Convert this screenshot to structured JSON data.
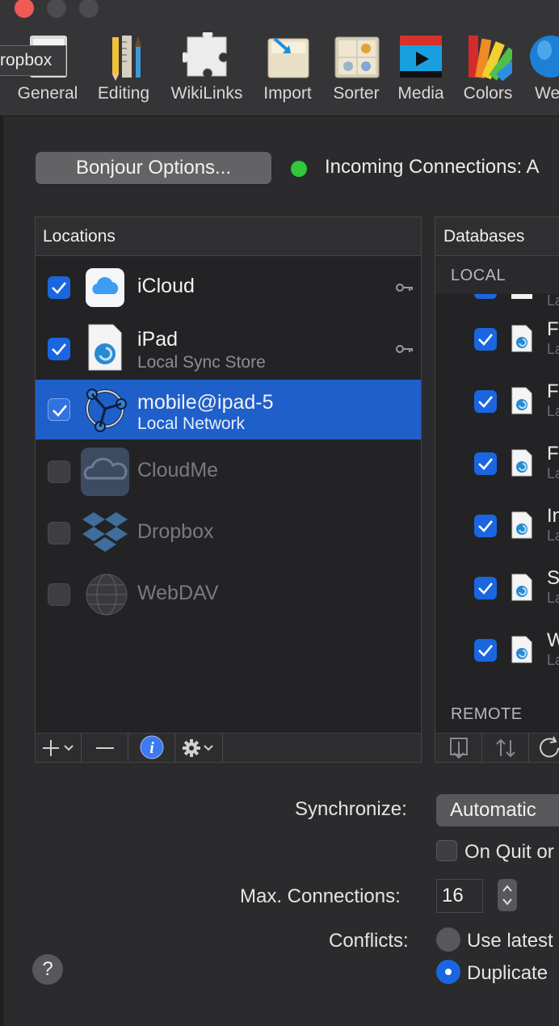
{
  "tooltip": "ropbox",
  "toolbar": {
    "items": [
      {
        "label": "General",
        "icon": "general-icon"
      },
      {
        "label": "Editing",
        "icon": "editing-icon"
      },
      {
        "label": "WikiLinks",
        "icon": "puzzle-icon"
      },
      {
        "label": "Import",
        "icon": "import-icon"
      },
      {
        "label": "Sorter",
        "icon": "sorter-icon"
      },
      {
        "label": "Media",
        "icon": "media-icon"
      },
      {
        "label": "Colors",
        "icon": "colors-icon"
      },
      {
        "label": "We",
        "icon": "globe-icon"
      }
    ]
  },
  "bonjour_button": "Bonjour Options...",
  "incoming_connections": "Incoming Connections: A",
  "locations": {
    "header": "Locations",
    "items": [
      {
        "name": "iCloud",
        "subtitle": "",
        "checked": true,
        "icon": "icloud-icon",
        "key": true
      },
      {
        "name": "iPad",
        "subtitle": "Local Sync Store",
        "checked": true,
        "icon": "ipad-document-icon",
        "key": true
      },
      {
        "name": "mobile@ipad-5",
        "subtitle": "Local Network",
        "checked": true,
        "icon": "bonjour-network-icon",
        "key": false,
        "selected": true
      },
      {
        "name": "CloudMe",
        "subtitle": "",
        "checked": false,
        "icon": "cloudme-icon",
        "key": false
      },
      {
        "name": "Dropbox",
        "subtitle": "",
        "checked": false,
        "icon": "dropbox-icon",
        "key": false
      },
      {
        "name": "WebDAV",
        "subtitle": "",
        "checked": false,
        "icon": "webdav-globe-icon",
        "key": false
      }
    ]
  },
  "databases": {
    "header": "Databases",
    "local_label": "LOCAL",
    "remote_label": "REMOTE",
    "rows": [
      {
        "title": "F",
        "sub": "La"
      },
      {
        "title": "F",
        "sub": "La"
      },
      {
        "title": "F",
        "sub": "La"
      },
      {
        "title": "In",
        "sub": "La"
      },
      {
        "title": "S",
        "sub": "La"
      },
      {
        "title": "W",
        "sub": "La"
      }
    ],
    "partial_top_sub": "La"
  },
  "form": {
    "synchronize_label": "Synchronize:",
    "synchronize_value": "Automatic",
    "on_quit_label": "On Quit or",
    "max_connections_label": "Max. Connections:",
    "max_connections_value": "16",
    "conflicts_label": "Conflicts:",
    "conflict_option_1": "Use latest",
    "conflict_option_2": "Duplicate"
  },
  "help": "?",
  "colors": {
    "accent": "#1a66e0",
    "selection": "#1f5fca",
    "status_online": "#2fc93a"
  }
}
